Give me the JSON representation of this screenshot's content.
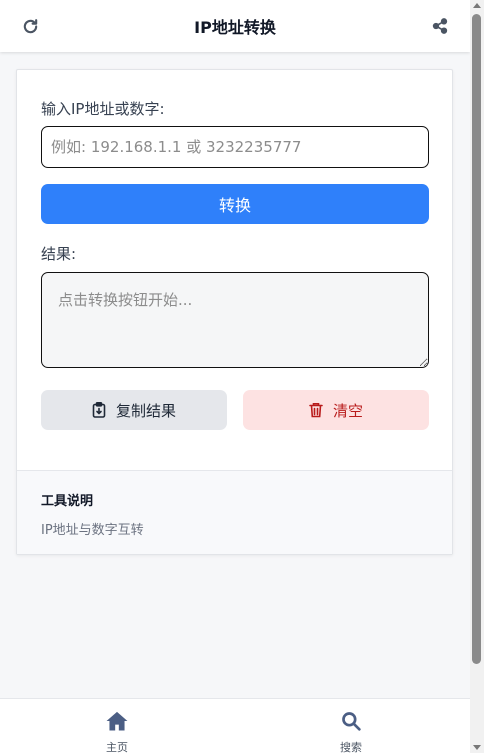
{
  "header": {
    "title": "IP地址转换",
    "left_icon": "refresh-icon",
    "right_icon": "share-icon"
  },
  "form": {
    "input_label": "输入IP地址或数字:",
    "input_value": "",
    "input_placeholder": "例如: 192.168.1.1 或 3232235777",
    "convert_label": "转换",
    "result_label": "结果:",
    "result_value": "",
    "result_placeholder": "点击转换按钮开始..."
  },
  "actions": {
    "copy_label": "复制结果",
    "copy_icon": "clipboard-icon",
    "clear_label": "清空",
    "clear_icon": "trash-icon"
  },
  "footer": {
    "title": "工具说明",
    "description": "IP地址与数字互转"
  },
  "bottom_nav": {
    "items": [
      {
        "label": "主页",
        "icon": "home-icon"
      },
      {
        "label": "搜索",
        "icon": "search-icon"
      }
    ]
  },
  "colors": {
    "primary": "#2f80fa",
    "danger_text": "#b91c1c",
    "danger_bg": "#fde2e2",
    "neutral_bg": "#e5e7eb"
  }
}
